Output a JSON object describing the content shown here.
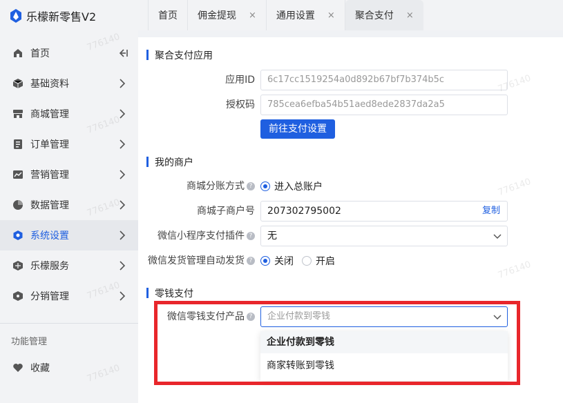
{
  "app": {
    "title": "乐檬新零售V2"
  },
  "tabs": [
    {
      "label": "首页",
      "closable": false,
      "active": false
    },
    {
      "label": "佣金提现",
      "closable": true,
      "active": false
    },
    {
      "label": "通用设置",
      "closable": true,
      "active": false
    },
    {
      "label": "聚合支付",
      "closable": true,
      "active": true
    }
  ],
  "tab_close_glyph": "×",
  "sidebar": {
    "items": [
      {
        "label": "首页",
        "icon": "home-icon"
      },
      {
        "label": "基础资料",
        "icon": "cube-icon"
      },
      {
        "label": "商城管理",
        "icon": "store-icon"
      },
      {
        "label": "订单管理",
        "icon": "order-icon"
      },
      {
        "label": "营销管理",
        "icon": "marketing-icon"
      },
      {
        "label": "数据管理",
        "icon": "pie-chart-icon"
      },
      {
        "label": "系统设置",
        "icon": "settings-hexagon-icon",
        "active": true
      },
      {
        "label": "乐檬服务",
        "icon": "service-icon"
      },
      {
        "label": "分销管理",
        "icon": "distribution-icon"
      }
    ],
    "section_label": "功能管理",
    "favorites_label": "收藏"
  },
  "sections": {
    "app_section": {
      "title": "聚合支付应用",
      "app_id_label": "应用ID",
      "app_id_value": "6c17cc1519254a0d892b67bf7b374b5c",
      "auth_code_label": "授权码",
      "auth_code_value": "785cea6efba54b51aed8ede2837da2a5",
      "button_label": "前往支付设置"
    },
    "merchant_section": {
      "title": "我的商户",
      "split_label": "商城分账方式",
      "split_option": "进入总账户",
      "sub_merchant_label": "商城子商户号",
      "sub_merchant_value": "207302795002",
      "copy_label": "复制",
      "mini_plugin_label": "微信小程序支付插件",
      "mini_plugin_value": "无",
      "auto_ship_label": "微信发货管理自动发货",
      "auto_ship_off": "关闭",
      "auto_ship_on": "开启"
    },
    "change_section": {
      "title": "零钱支付",
      "product_label": "微信零钱支付产品",
      "product_placeholder": "企业付款到零钱",
      "options": [
        "企业付款到零钱",
        "商家转账到零钱"
      ]
    }
  },
  "help_glyph": "?",
  "watermark_text": "776140",
  "colors": {
    "accent": "#1f5fe0",
    "highlight_box": "#e8262b"
  }
}
